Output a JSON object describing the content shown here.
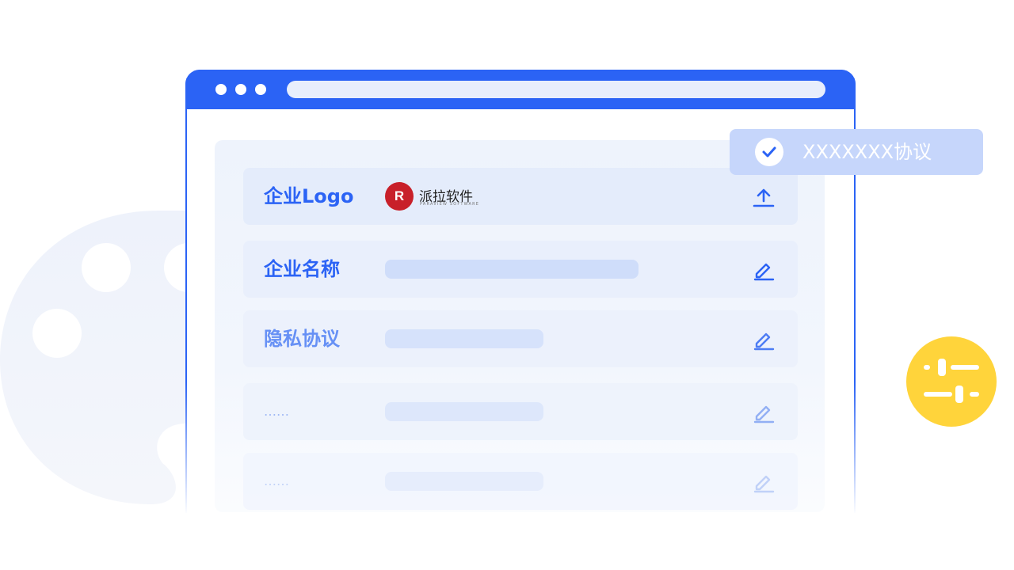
{
  "form": {
    "rows": [
      {
        "label": "企业Logo",
        "action": "upload-icon"
      },
      {
        "label": "企业名称",
        "action": "edit-icon"
      },
      {
        "label": "隐私协议",
        "action": "edit-icon"
      },
      {
        "label": "……",
        "action": "edit-icon"
      },
      {
        "label": "……",
        "action": "edit-icon"
      }
    ],
    "logo": {
      "mark": "R",
      "name_cn": "派拉软件",
      "name_en": "PARAVIEW SOFTWARE"
    }
  },
  "toast": {
    "text": "XXXXXXX协议",
    "icon": "check-circle-icon"
  },
  "badge": {
    "icon": "sliders-icon"
  },
  "colors": {
    "brand_blue": "#2b63f5",
    "panel_bg": "#eef3fc",
    "toast_bg": "#c6d6fb",
    "badge_yellow": "#ffd43b",
    "logo_red": "#c8202a"
  }
}
